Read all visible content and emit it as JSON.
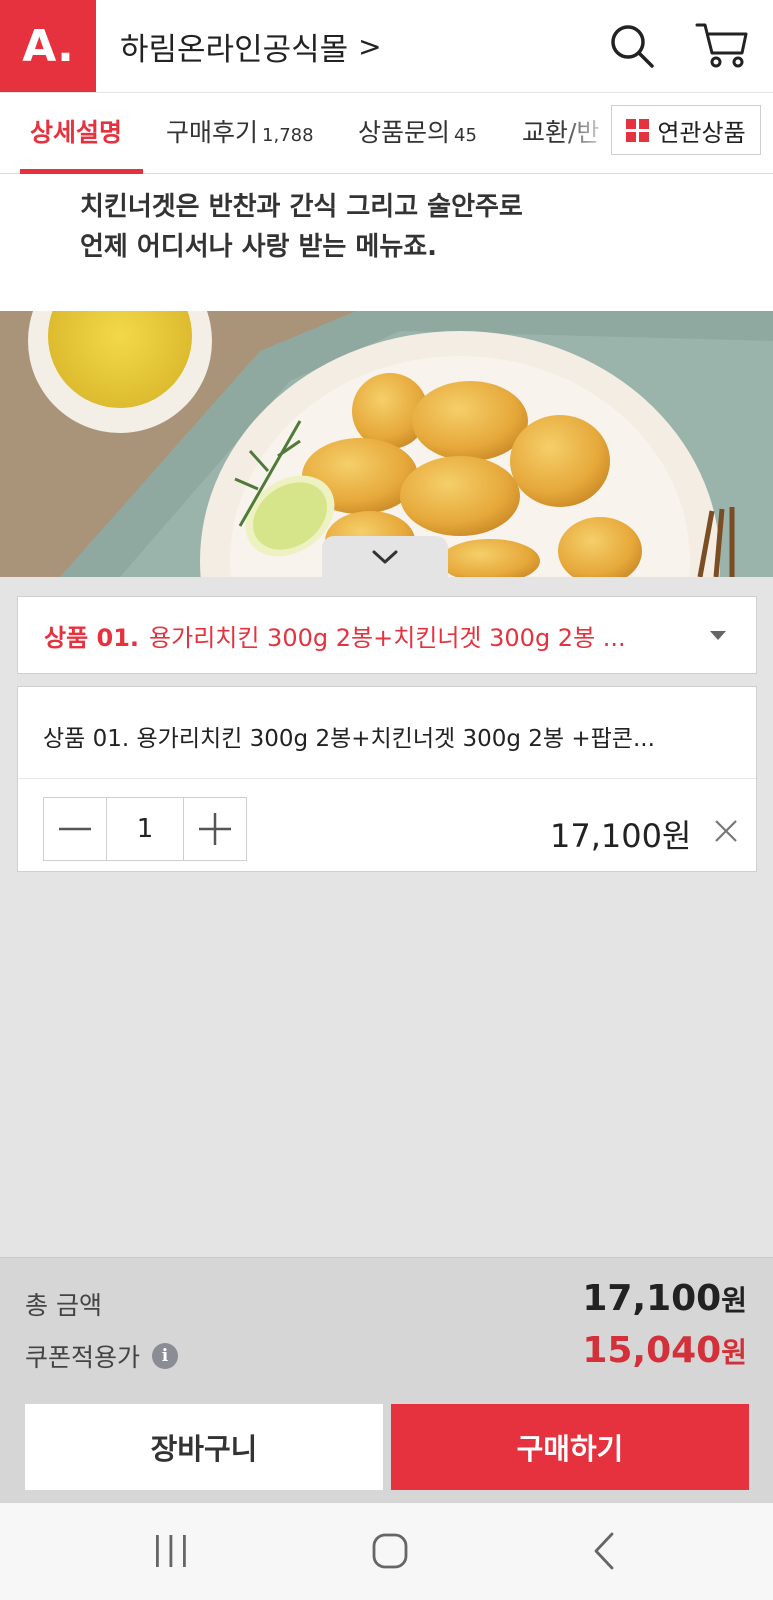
{
  "header": {
    "logo_text": "A.",
    "store_name": "하림온라인공식몰",
    "store_chevron": ">"
  },
  "tabs": {
    "items": [
      {
        "label": "상세설명",
        "count": "",
        "active": true
      },
      {
        "label": "구매후기",
        "count": "1,788",
        "active": false
      },
      {
        "label": "상품문의",
        "count": "45",
        "active": false
      },
      {
        "label": "교환/반",
        "count": "",
        "active": false
      }
    ],
    "related_label": "연관상품"
  },
  "description": {
    "line1": "치킨너겟은 반찬과 간식 그리고 술안주로",
    "line2": "언제 어디서나 사랑 받는 메뉴죠."
  },
  "option_select": {
    "prefix": "상품 01.",
    "text": "용가리치킨 300g 2봉+치킨너겟 300g 2봉 ..."
  },
  "selected_item": {
    "name": "상품 01. 용가리치킨 300g 2봉+치킨너겟 300g 2봉 +팝콘...",
    "quantity": "1",
    "price": "17,100원"
  },
  "summary": {
    "total_label": "총 금액",
    "total_value": "17,100",
    "total_unit": "원",
    "coupon_label": "쿠폰적용가",
    "coupon_info": "i",
    "coupon_value": "15,040",
    "coupon_unit": "원"
  },
  "actions": {
    "cart_label": "장바구니",
    "buy_label": "구매하기"
  },
  "colors": {
    "accent": "#e6323e",
    "coupon_price": "#d3303a"
  },
  "icons": {
    "search": "search-icon",
    "cart": "cart-icon",
    "grid": "grid-icon",
    "chevron_down": "chevron-down-icon",
    "minus": "minus-icon",
    "plus": "plus-icon",
    "close": "close-icon",
    "info": "info-icon"
  }
}
